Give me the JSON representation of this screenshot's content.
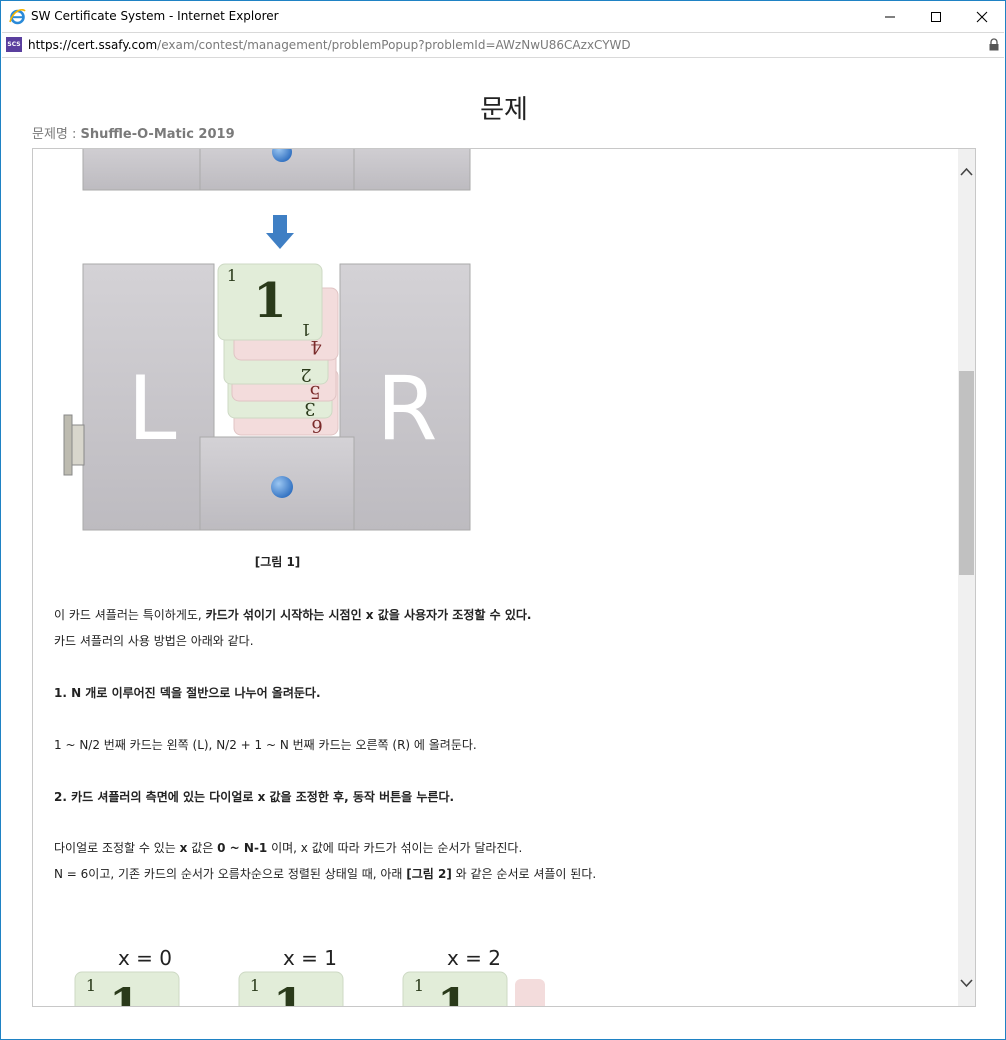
{
  "window": {
    "title": "SW Certificate System - Internet Explorer",
    "url_host": "https://cert.ssafy.com",
    "url_path": "/exam/contest/management/problemPopup?problemId=AWzNwU86CAzxCYWD",
    "site_icon_text": "SCS"
  },
  "page": {
    "heading": "문제",
    "problem_label": "문제명 : ",
    "problem_name": "Shuffle-O-Matic 2019"
  },
  "figure1": {
    "left_label": "L",
    "right_label": "R",
    "caption": "[그림 1]",
    "cards": [
      {
        "value": "1",
        "color": "green"
      },
      {
        "value": "4",
        "color": "pink"
      },
      {
        "value": "2",
        "color": "green"
      },
      {
        "value": "5",
        "color": "pink"
      },
      {
        "value": "3",
        "color": "green"
      },
      {
        "value": "6",
        "color": "pink"
      }
    ]
  },
  "text": {
    "p1_a": "이 카드 셔플러는 특이하게도, ",
    "p1_b": "카드가 섞이기 시작하는 시점인 x 값을 사용자가 조정할 수 있다.",
    "p2": "카드 셔플러의 사용 방법은 아래와 같다.",
    "step1": "1. N 개로 이루어진 덱을 절반으로 나누어 올려둔다.",
    "step1_desc": "1 ~ N/2 번째 카드는 왼쪽 (L), N/2 + 1 ~ N 번째 카드는 오른쪽 (R) 에 올려둔다.",
    "step2": "2. 카드 셔플러의 측면에 있는 다이얼로 x 값을 조정한 후, 동작 버튼을 누른다.",
    "p3_a": "다이얼로 조정할 수 있는 ",
    "p3_b": "x",
    "p3_c": " 값은 ",
    "p3_d": "0 ~ N-1",
    "p3_e": " 이며, x 값에 따라 카드가 섞이는 순서가 달라진다.",
    "p4_a": "N = 6이고, 기존 카드의 순서가 오름차순으로 정렬된 상태일 때, 아래 ",
    "p4_b": "[그림 2]",
    "p4_c": " 와 같은 순서로 셔플이 된다."
  },
  "figure2": {
    "labels": [
      "x = 0",
      "x = 1",
      "x = 2"
    ],
    "card_value": "1"
  },
  "colors": {
    "shuffler_body": "#c8c6cb",
    "card_green": "#e2edd9",
    "card_pink": "#f3dcdc",
    "arrow": "#3f7fc4",
    "button": "#3b82d4",
    "window_border": "#1f82c4"
  }
}
